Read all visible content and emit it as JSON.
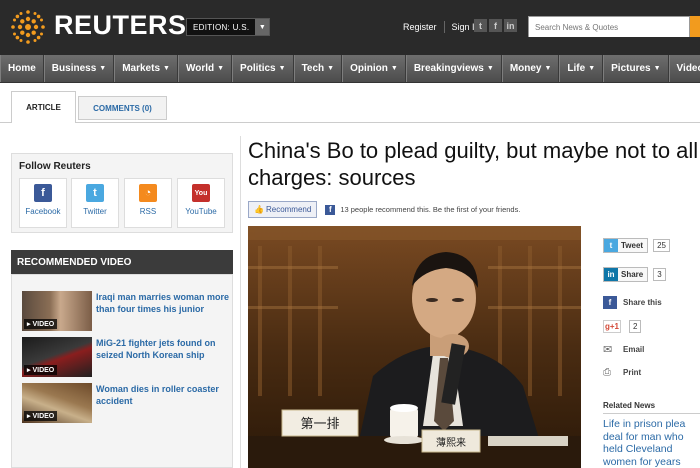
{
  "header": {
    "brand": "REUTERS",
    "edition_label": "EDITION: U.S.",
    "register": "Register",
    "sign_in": "Sign In",
    "social_t": "t",
    "social_f": "f",
    "social_in": "in",
    "search_placeholder": "Search News & Quotes"
  },
  "nav": [
    "Home",
    "Business",
    "Markets",
    "World",
    "Politics",
    "Tech",
    "Opinion",
    "Breakingviews",
    "Money",
    "Life",
    "Pictures",
    "Video"
  ],
  "tabs": {
    "article": "ARTICLE",
    "comments": "COMMENTS (0)"
  },
  "follow": {
    "title": "Follow Reuters",
    "items": [
      {
        "label": "Facebook",
        "glyph": "f",
        "color": "#3b5998"
      },
      {
        "label": "Twitter",
        "glyph": "t",
        "color": "#4aa8e0"
      },
      {
        "label": "RSS",
        "glyph": "◔",
        "color": "#f48a1e"
      },
      {
        "label": "YouTube",
        "glyph": "You",
        "color": "#c4302b"
      }
    ]
  },
  "recommended": {
    "title": "RECOMMENDED VIDEO",
    "tag": "VIDEO",
    "items": [
      {
        "title": "Iraqi man marries woman more than four times his junior"
      },
      {
        "title": "MiG-21 fighter jets found on seized North Korean ship"
      },
      {
        "title": "Woman dies in roller coaster accident"
      }
    ]
  },
  "article": {
    "headline": "China's Bo to plead guilty, but maybe not to all charges: sources",
    "recommend_label": "Recommend",
    "recommend_text": "13 people recommend this. Be the first of your friends.",
    "photo_placard": "第一排",
    "photo_nameplate": "薄熙来"
  },
  "share": {
    "tweet": "Tweet",
    "tweet_count": "25",
    "linkedin": "Share",
    "linkedin_count": "3",
    "facebook": "Share this",
    "gplus_count": "2",
    "email": "Email",
    "print": "Print"
  },
  "related": {
    "title": "Related News",
    "link": "Life in prison plea deal for man who held Cleveland women for years"
  },
  "colors": {
    "accent_orange": "#f29b1e",
    "link_blue": "#2b6aa6",
    "nav_gray": "#5c5c5c",
    "header_dark": "#2a2a2a"
  }
}
